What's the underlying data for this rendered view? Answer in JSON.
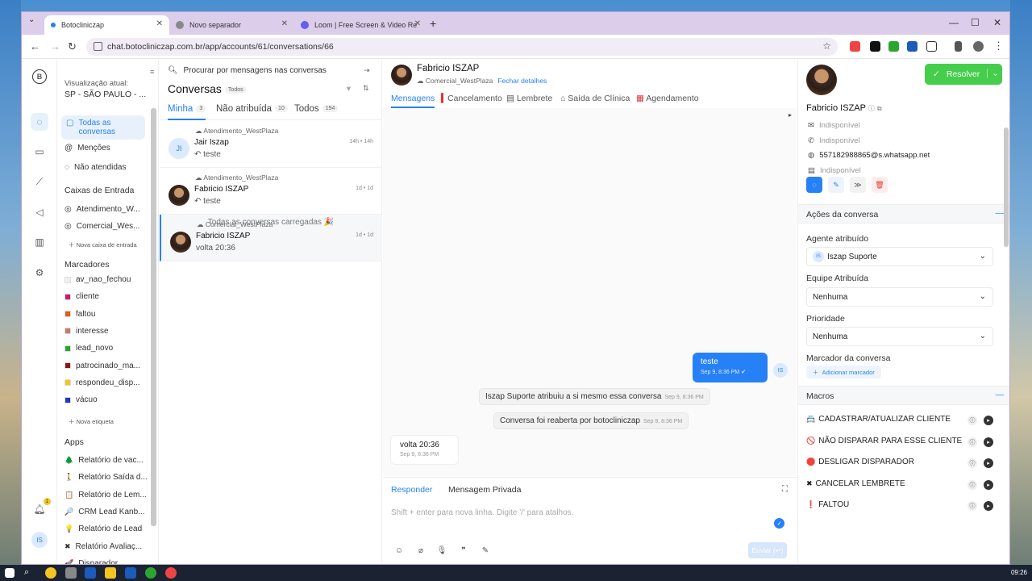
{
  "browser": {
    "tabs": [
      {
        "label": "Botocliniczap"
      },
      {
        "label": "Novo separador"
      },
      {
        "label": "Loom | Free Screen & Video Re"
      }
    ],
    "url": "chat.botocliniczap.com.br/app/accounts/61/conversations/66"
  },
  "sidebar": {
    "view_label": "Visualização atual:",
    "account": "SP - SÃO PAULO - ...",
    "items": [
      {
        "label": "Todas as conversas"
      },
      {
        "label": "Menções"
      },
      {
        "label": "Não atendidas"
      }
    ],
    "inbox_title": "Caixas de Entrada",
    "inboxes": [
      {
        "label": "Atendimento_W..."
      },
      {
        "label": "Comercial_Wes..."
      }
    ],
    "new_inbox": "Nova caixa de entrada",
    "labels_title": "Marcadores",
    "labels": [
      {
        "label": "av_nao_fechou",
        "color": "#f0f0f0"
      },
      {
        "label": "cliente",
        "color": "#d5156b"
      },
      {
        "label": "faltou",
        "color": "#e15a17"
      },
      {
        "label": "interesse",
        "color": "#c7796a"
      },
      {
        "label": "lead_novo",
        "color": "#2aa530"
      },
      {
        "label": "patrocinado_ma...",
        "color": "#8b1616"
      },
      {
        "label": "respondeu_disp...",
        "color": "#f4c520"
      },
      {
        "label": "vácuo",
        "color": "#1b3bbb"
      }
    ],
    "new_label": "Nova etiqueta",
    "apps_title": "Apps",
    "apps": [
      {
        "label": "Relatório de vac..."
      },
      {
        "label": "Relatório Saída d..."
      },
      {
        "label": "Relatório de Lem..."
      },
      {
        "label": "CRM Lead Kanb..."
      },
      {
        "label": "Relatório de Lead"
      },
      {
        "label": "Relatório Avaliaç..."
      },
      {
        "label": "Disparador"
      }
    ],
    "notif_count": "1",
    "user_initials": "IS"
  },
  "conversations": {
    "search_placeholder": "Procurar por mensagens nas conversas",
    "title": "Conversas",
    "filter_badge": "Todos",
    "tabs": [
      {
        "label": "Minha",
        "count": "3"
      },
      {
        "label": "Não atribuída",
        "count": "10"
      },
      {
        "label": "Todos",
        "count": "194"
      }
    ],
    "items": [
      {
        "inbox": "Atendimento_WestPlaza",
        "name": "Jair Iszap",
        "message": "↶ teste",
        "time": "14h • 14h",
        "initials": "JI"
      },
      {
        "inbox": "Atendimento_WestPlaza",
        "name": "Fabricio ISZAP",
        "message": "↶ teste",
        "time": "1d • 1d",
        "initials": ""
      },
      {
        "inbox": "Comercial_WestPlaza",
        "name": "Fabricio ISZAP",
        "message": "volta 20:36",
        "time": "1d • 1d",
        "initials": ""
      }
    ],
    "loaded_text": "Todas as conversas carregadas 🎉"
  },
  "chat": {
    "contact_name": "Fabricio ISZAP",
    "inbox": "Comercial_WestPlaza",
    "close_details": "Fechar detalhes",
    "tabs": [
      {
        "label": "Mensagens"
      },
      {
        "label": "Cancelamento"
      },
      {
        "label": "Lembrete"
      },
      {
        "label": "Saída de Clínica"
      },
      {
        "label": "Agendamento"
      }
    ],
    "resolve_label": "Resolver",
    "messages": {
      "outgoing_text": "teste",
      "outgoing_time": "Sep 9, 8:36 PM",
      "agent_initials": "IS",
      "activity1": "Iszap Suporte atribuiu a si mesmo essa conversa",
      "activity1_time": "Sep 9, 8:36 PM",
      "activity2": "Conversa foi reaberta por botocliniczap",
      "activity2_time": "Sep 9, 8:36 PM",
      "incoming_text": "volta 20:36",
      "incoming_time": "Sep 9, 8:36 PM"
    },
    "composer": {
      "reply_tab": "Responder",
      "private_tab": "Mensagem Privada",
      "placeholder": "Shift + enter para nova linha. Digite '/' para atalhos.",
      "send_label": "Enviar (↵)"
    }
  },
  "contact": {
    "name": "Fabricio ISZAP",
    "email": "Indisponível",
    "phone": "Indisponível",
    "whatsapp": "557182988865@s.whatsapp.net",
    "company": "Indisponível",
    "actions_title": "Ações da conversa",
    "agent_label": "Agente atribuído",
    "agent_value": "Iszap Suporte",
    "agent_initials": "IS",
    "team_label": "Equipe Atribuída",
    "team_value": "Nenhuma",
    "priority_label": "Prioridade",
    "priority_value": "Nenhuma",
    "tag_label": "Marcador da conversa",
    "add_tag": "Adicionar marcador",
    "macros_title": "Macros",
    "macros": [
      {
        "label": "CADASTRAR/ATUALIZAR CLIENTE",
        "icon": "📇"
      },
      {
        "label": "NÃO DISPARAR PARA ESSE CLIENTE",
        "icon": "🚫"
      },
      {
        "label": "DESLIGAR DISPARADOR",
        "icon": "🛑"
      },
      {
        "label": "CANCELAR LEMBRETE",
        "icon": "✖"
      },
      {
        "label": "FALTOU",
        "icon": "❗"
      }
    ]
  },
  "taskbar": {
    "clock": "09:26"
  }
}
